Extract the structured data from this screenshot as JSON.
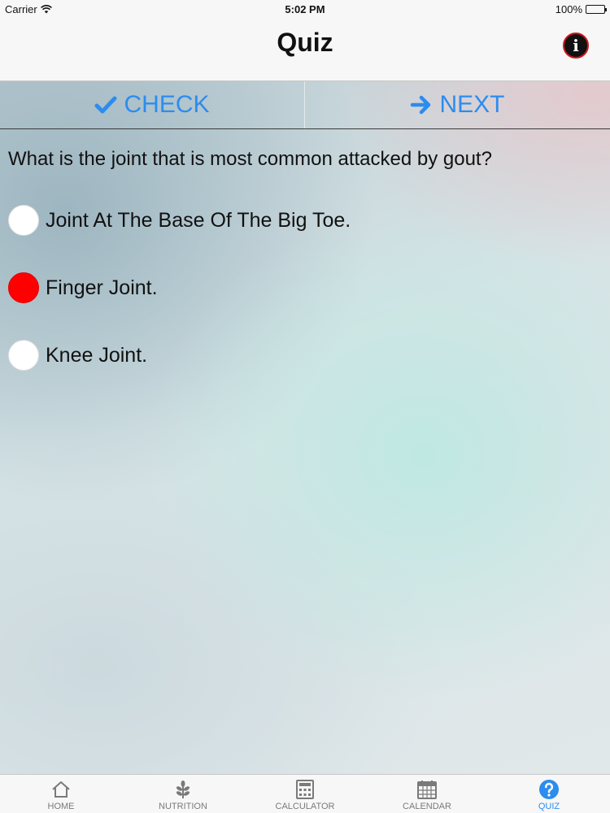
{
  "status_bar": {
    "carrier": "Carrier",
    "time": "5:02 PM",
    "battery": "100%"
  },
  "nav": {
    "title": "Quiz",
    "info_icon": "info-icon"
  },
  "actions": {
    "check_label": "CHECK",
    "next_label": "NEXT",
    "accent_color": "#2c8cef"
  },
  "quiz": {
    "question": "What is the joint that is most common attacked by gout?",
    "options": [
      {
        "label": "Joint At The Base Of The Big Toe.",
        "selected": false
      },
      {
        "label": "Finger Joint.",
        "selected": true
      },
      {
        "label": "Knee Joint.",
        "selected": false
      }
    ],
    "selected_color": "#ff0000"
  },
  "tabs": [
    {
      "label": "HOME",
      "icon": "home-icon",
      "active": false
    },
    {
      "label": "NUTRITION",
      "icon": "leaf-icon",
      "active": false
    },
    {
      "label": "CALCULATOR",
      "icon": "calculator-icon",
      "active": false
    },
    {
      "label": "CALENDAR",
      "icon": "calendar-icon",
      "active": false
    },
    {
      "label": "QUIZ",
      "icon": "question-icon",
      "active": true
    }
  ]
}
